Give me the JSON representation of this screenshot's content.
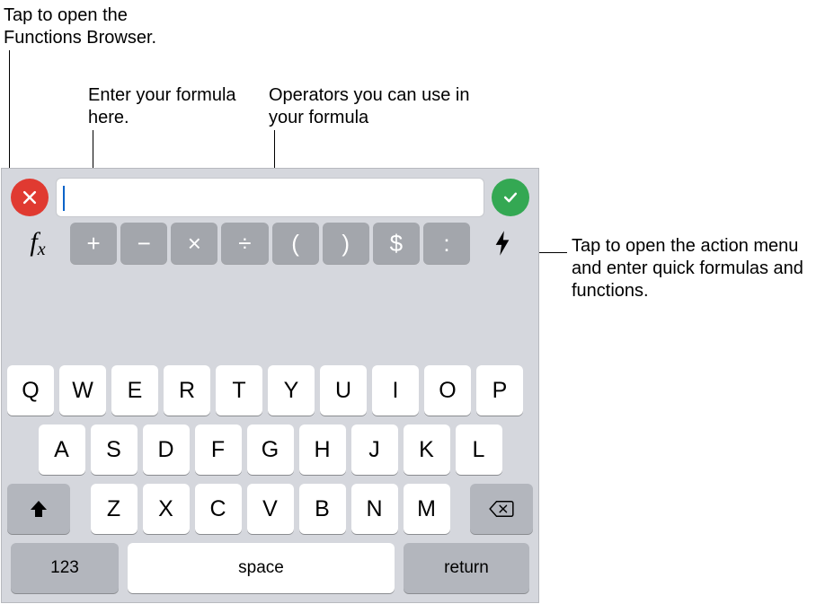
{
  "callouts": {
    "functions_browser": "Tap to open the Functions Browser.",
    "formula_field": "Enter your formula here.",
    "operators_hint": "Operators you can use in your formula",
    "action_menu": "Tap to open the action menu and enter quick formulas and functions."
  },
  "formula_bar": {
    "cancel_icon": "close-icon",
    "accept_icon": "check-icon",
    "input_value": "",
    "fx_label_main": "f",
    "fx_label_sub": "x",
    "action_icon": "bolt-icon"
  },
  "operators": [
    "+",
    "−",
    "×",
    "÷",
    "(",
    ")",
    "$",
    ":"
  ],
  "keyboard": {
    "row1": [
      "Q",
      "W",
      "E",
      "R",
      "T",
      "Y",
      "U",
      "I",
      "O",
      "P"
    ],
    "row2": [
      "A",
      "S",
      "D",
      "F",
      "G",
      "H",
      "J",
      "K",
      "L"
    ],
    "row3": [
      "Z",
      "X",
      "C",
      "V",
      "B",
      "N",
      "M"
    ],
    "shift_icon": "shift-icon",
    "delete_icon": "delete-icon",
    "num_switch": "123",
    "space_label": "space",
    "return_label": "return"
  }
}
